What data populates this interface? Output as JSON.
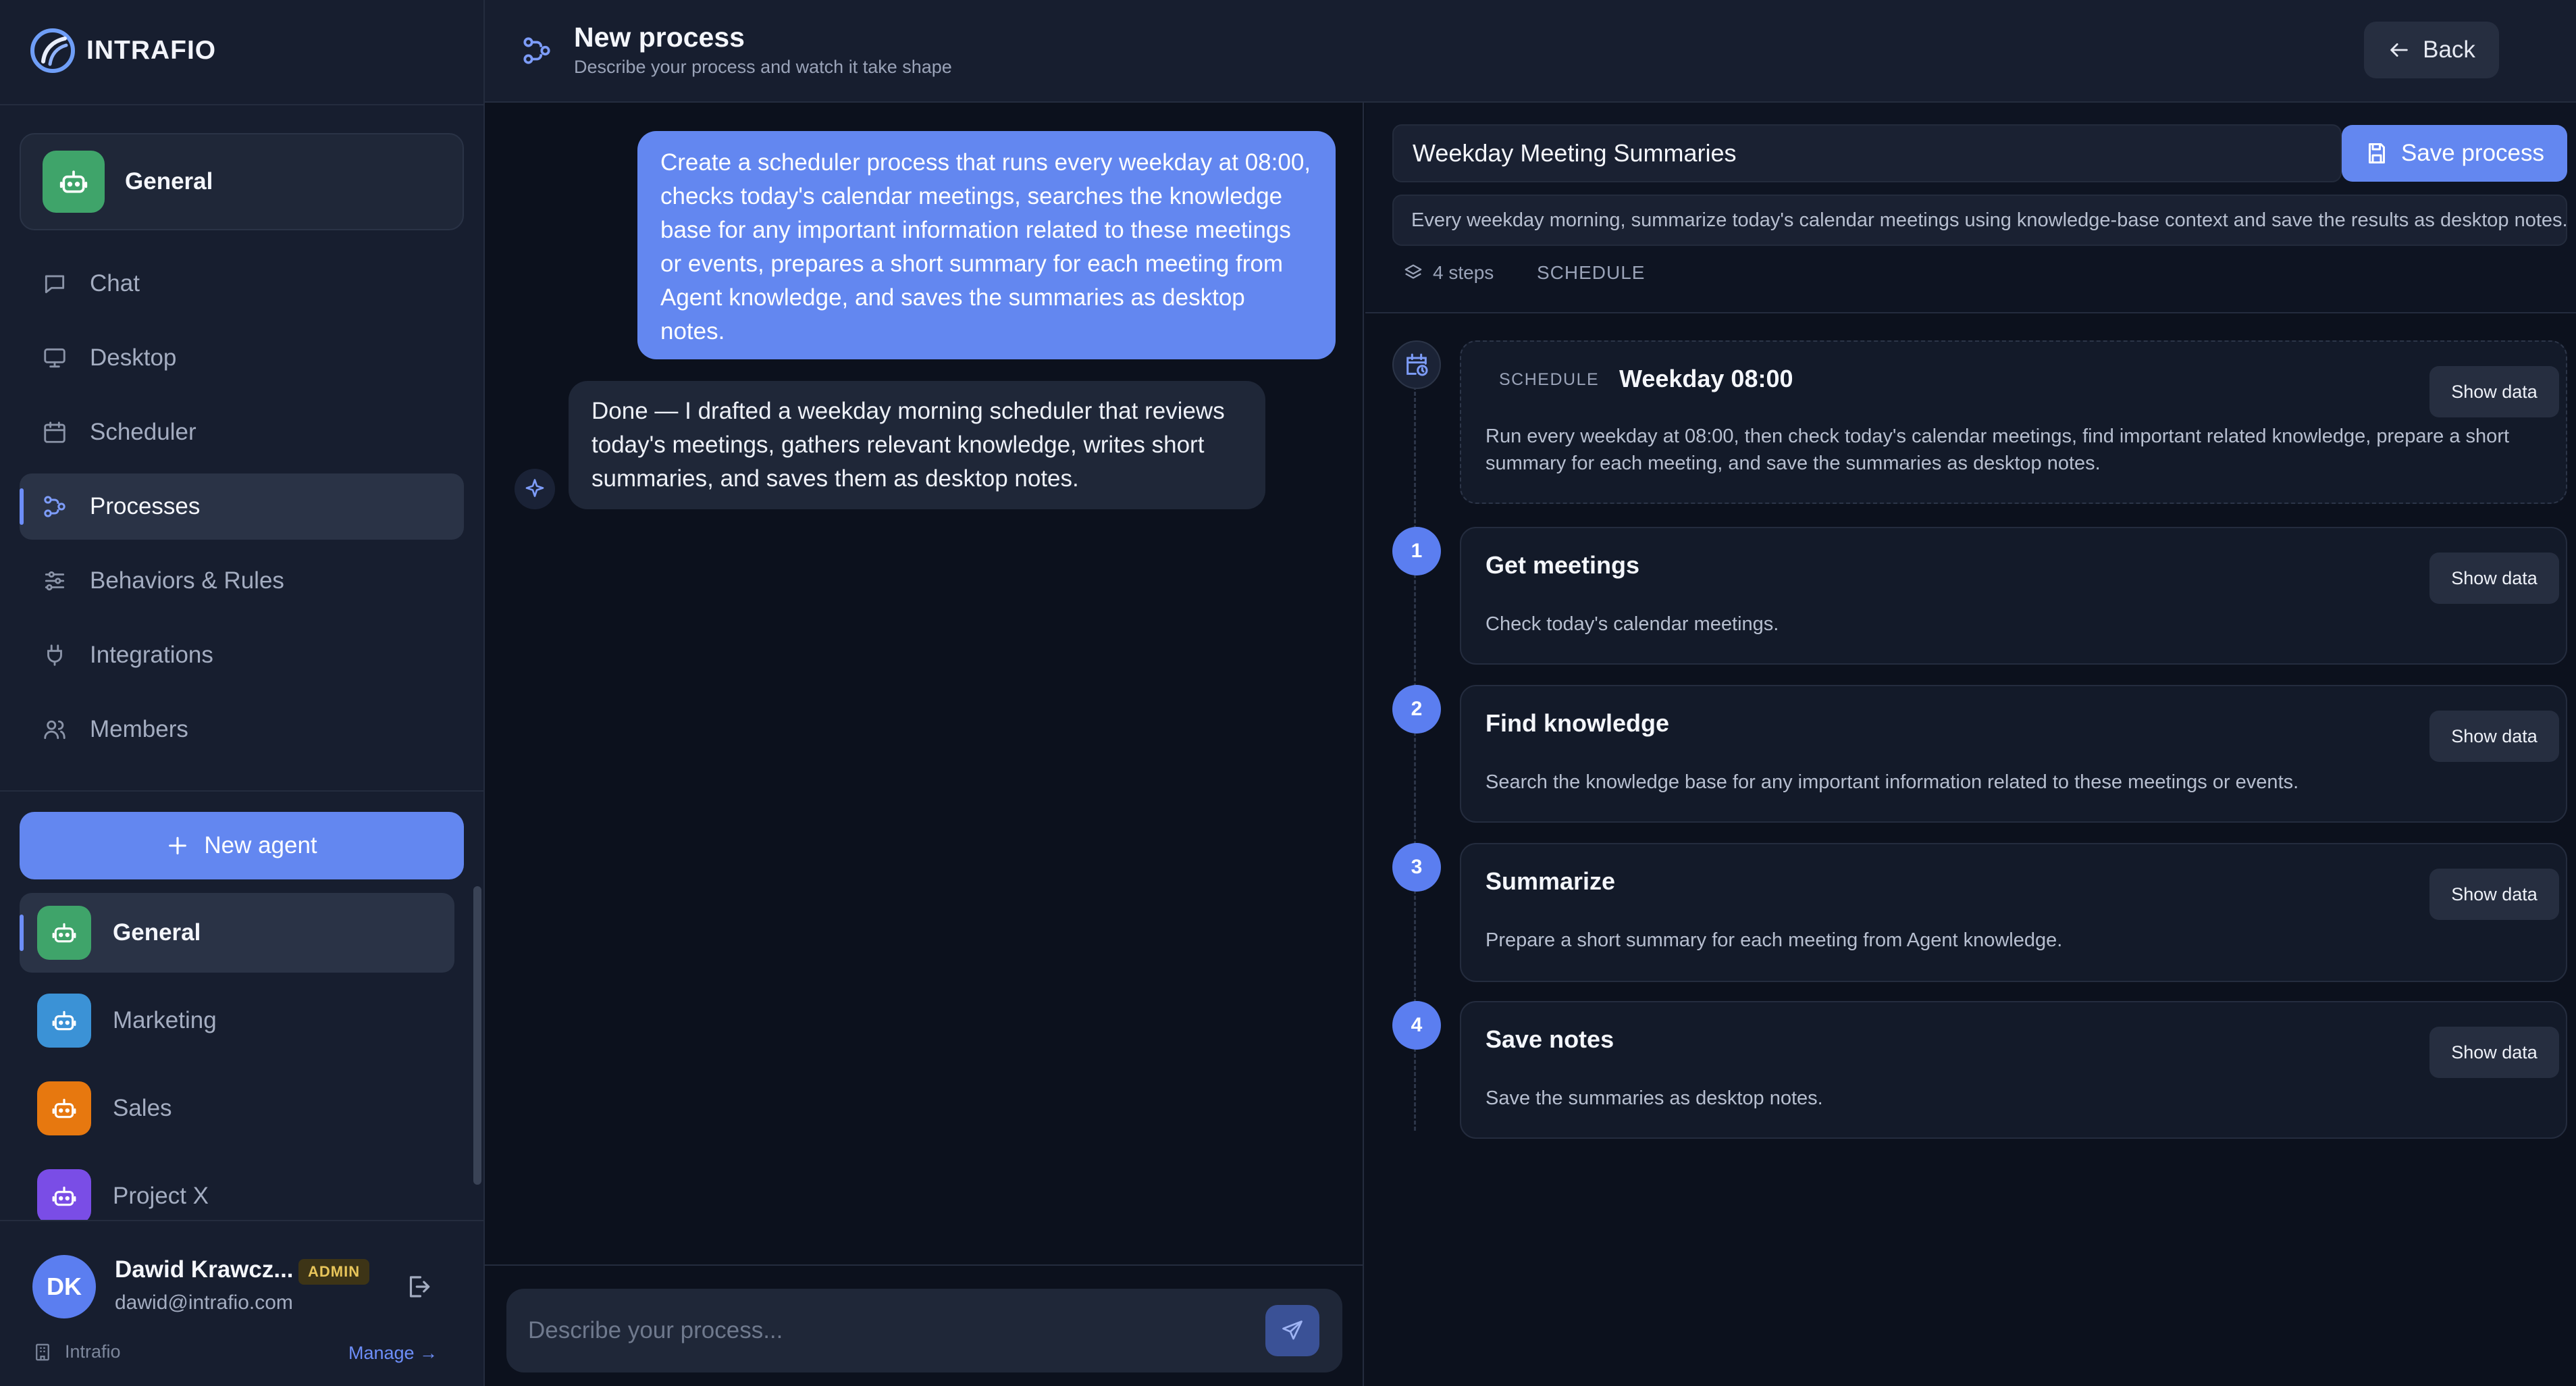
{
  "brand": {
    "name": "INTRAFIO"
  },
  "sidebar": {
    "current_agent": "General",
    "nav": [
      {
        "label": "Chat",
        "icon": "chat-icon"
      },
      {
        "label": "Desktop",
        "icon": "desktop-icon"
      },
      {
        "label": "Scheduler",
        "icon": "calendar-icon"
      },
      {
        "label": "Processes",
        "icon": "processes-icon",
        "active": true
      },
      {
        "label": "Behaviors & Rules",
        "icon": "sliders-icon"
      },
      {
        "label": "Integrations",
        "icon": "plug-icon"
      },
      {
        "label": "Members",
        "icon": "members-icon"
      }
    ],
    "new_agent_label": "New agent",
    "agents": [
      {
        "label": "General",
        "color": "#3fa46a",
        "active": true
      },
      {
        "label": "Marketing",
        "color": "#3b92d6"
      },
      {
        "label": "Sales",
        "color": "#e7780f"
      },
      {
        "label": "Project X",
        "color": "#7a4de6"
      }
    ],
    "user": {
      "initials": "DK",
      "name": "Dawid Krawcz...",
      "role_badge": "ADMIN",
      "email": "dawid@intrafio.com"
    },
    "org": {
      "name": "Intrafio",
      "manage_label": "Manage →"
    }
  },
  "header": {
    "title": "New process",
    "subtitle": "Describe your process and watch it take shape",
    "back_label": "Back"
  },
  "chat": {
    "user_message": "Create a scheduler process that runs every weekday at 08:00, checks today's calendar meetings, searches the knowledge base for any important information related to these meetings or events, prepares a short summary for each meeting from Agent knowledge, and saves the summaries as desktop notes.",
    "ai_message": "Done — I drafted a weekday morning scheduler that reviews today's meetings, gathers relevant knowledge, writes short summaries, and saves them as desktop notes.",
    "input_placeholder": "Describe your process..."
  },
  "process": {
    "name": "Weekday Meeting Summaries",
    "save_label": "Save process",
    "description": "Every weekday morning, summarize today's calendar meetings using knowledge-base context and save the results as desktop notes.",
    "steps_count_label": "4 steps",
    "type_label": "SCHEDULE",
    "schedule": {
      "tag": "SCHEDULE",
      "title": "Weekday 08:00",
      "text": "Run every weekday at 08:00, then check today's calendar meetings, find important related knowledge, prepare a short summary for each meeting, and save the summaries as desktop notes."
    },
    "show_data_label": "Show data",
    "steps": [
      {
        "number": "1",
        "title": "Get meetings",
        "text": "Check today's calendar meetings."
      },
      {
        "number": "2",
        "title": "Find knowledge",
        "text": "Search the knowledge base for any important information related to these meetings or events."
      },
      {
        "number": "3",
        "title": "Summarize",
        "text": "Prepare a short summary for each meeting from Agent knowledge."
      },
      {
        "number": "4",
        "title": "Save notes",
        "text": "Save the summaries as desktop notes."
      }
    ]
  },
  "colors": {
    "accent": "#6387f0",
    "background": "#0c111d",
    "sidebar": "#171e2f"
  }
}
